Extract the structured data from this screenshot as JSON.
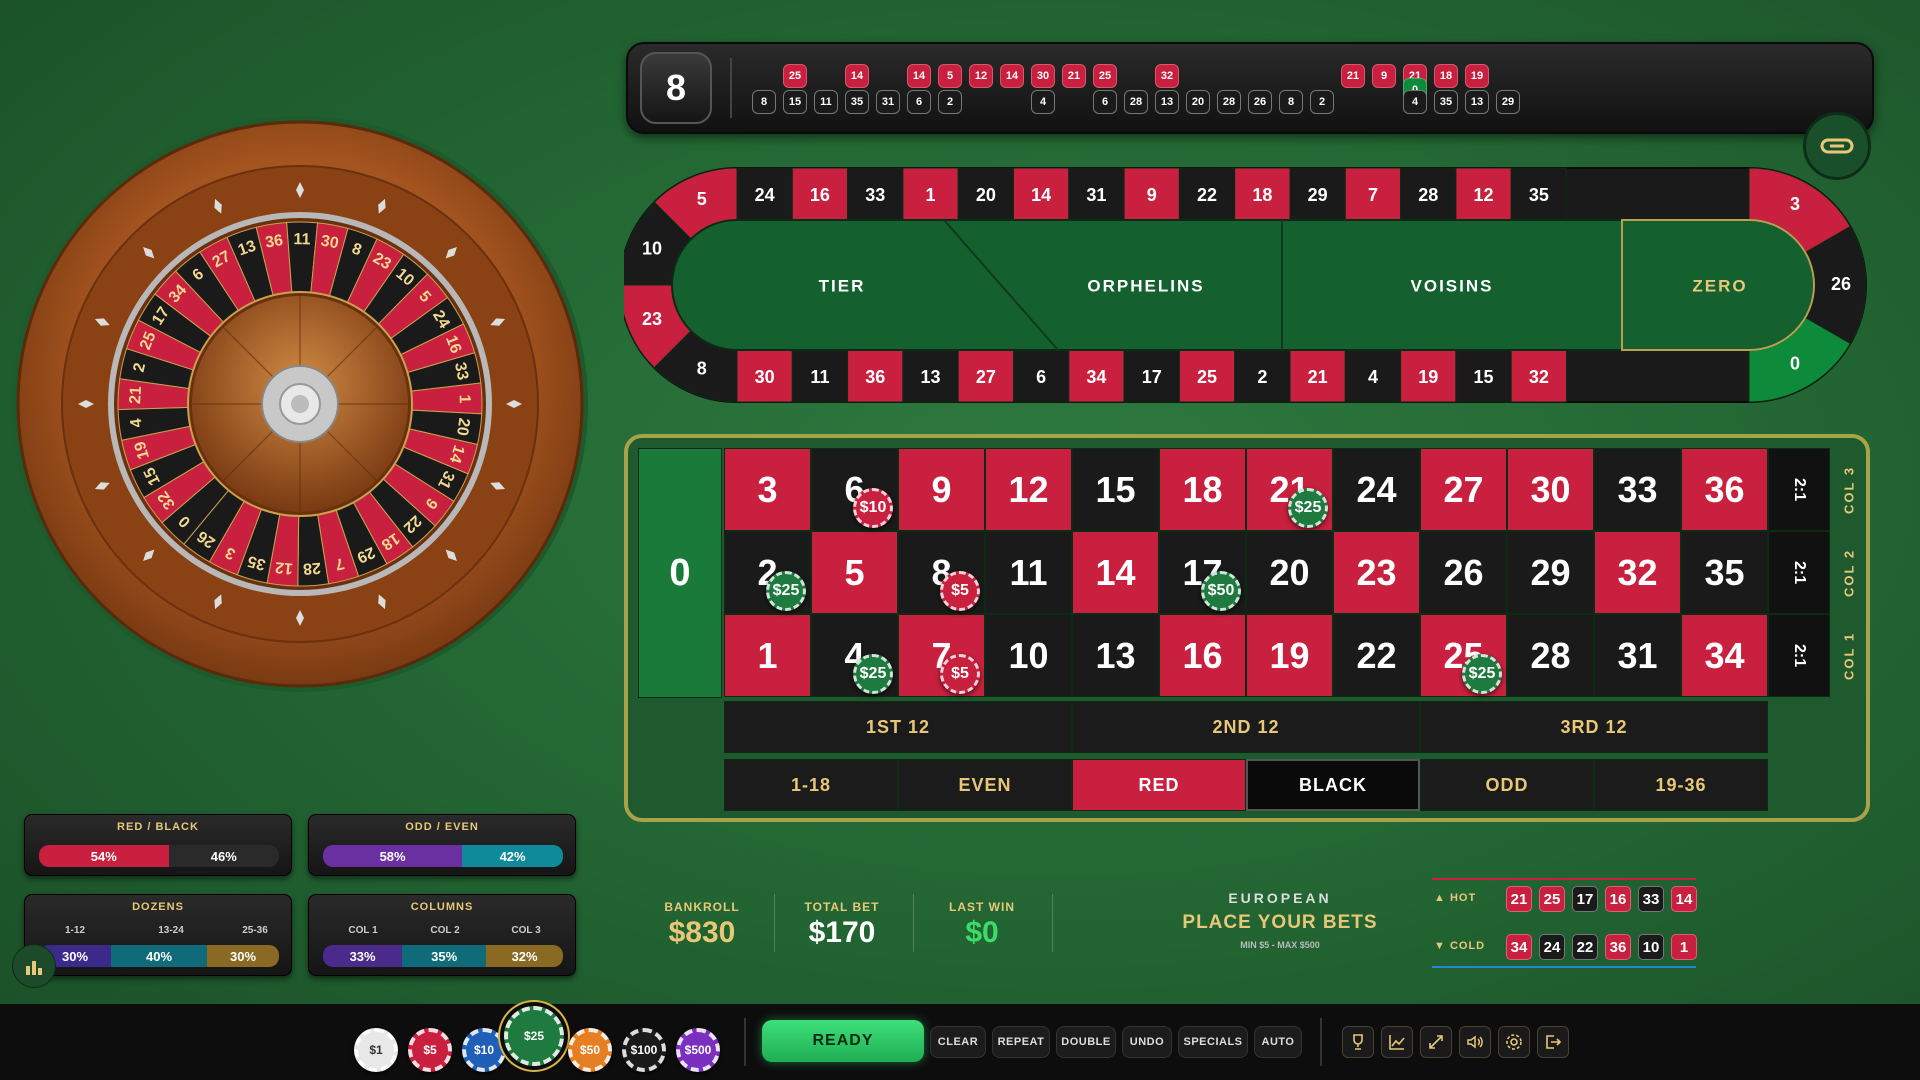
{
  "last_number": "8",
  "history": [
    {
      "n": "8",
      "c": "black",
      "row": "b"
    },
    {
      "n": "25",
      "c": "red",
      "row": "t"
    },
    {
      "n": "15",
      "c": "black",
      "row": "b"
    },
    {
      "n": "11",
      "c": "black",
      "row": "b"
    },
    {
      "n": "14",
      "c": "red",
      "row": "t"
    },
    {
      "n": "35",
      "c": "black",
      "row": "b"
    },
    {
      "n": "31",
      "c": "black",
      "row": "b"
    },
    {
      "n": "14",
      "c": "red",
      "row": "t"
    },
    {
      "n": "6",
      "c": "black",
      "row": "b"
    },
    {
      "n": "5",
      "c": "red",
      "row": "t"
    },
    {
      "n": "2",
      "c": "black",
      "row": "b"
    },
    {
      "n": "12",
      "c": "red",
      "row": "t"
    },
    {
      "n": "14",
      "c": "red",
      "row": "t"
    },
    {
      "n": "30",
      "c": "red",
      "row": "t"
    },
    {
      "n": "4",
      "c": "black",
      "row": "b"
    },
    {
      "n": "21",
      "c": "red",
      "row": "t"
    },
    {
      "n": "25",
      "c": "red",
      "row": "t"
    },
    {
      "n": "6",
      "c": "black",
      "row": "b"
    },
    {
      "n": "28",
      "c": "black",
      "row": "b"
    },
    {
      "n": "32",
      "c": "red",
      "row": "t"
    },
    {
      "n": "13",
      "c": "black",
      "row": "b"
    },
    {
      "n": "20",
      "c": "black",
      "row": "b"
    },
    {
      "n": "28",
      "c": "black",
      "row": "b"
    },
    {
      "n": "26",
      "c": "black",
      "row": "b"
    },
    {
      "n": "8",
      "c": "black",
      "row": "b"
    },
    {
      "n": "2",
      "c": "black",
      "row": "b"
    },
    {
      "n": "21",
      "c": "red",
      "row": "t"
    },
    {
      "n": "9",
      "c": "red",
      "row": "t"
    },
    {
      "n": "21",
      "c": "red",
      "row": "t"
    },
    {
      "n": "0",
      "c": "green",
      "row": "m"
    },
    {
      "n": "4",
      "c": "black",
      "row": "b"
    },
    {
      "n": "18",
      "c": "red",
      "row": "t"
    },
    {
      "n": "35",
      "c": "black",
      "row": "b"
    },
    {
      "n": "19",
      "c": "red",
      "row": "t"
    },
    {
      "n": "13",
      "c": "black",
      "row": "b"
    },
    {
      "n": "29",
      "c": "black",
      "row": "b"
    }
  ],
  "racetrack": {
    "top": [
      {
        "n": "24",
        "c": "black"
      },
      {
        "n": "16",
        "c": "red"
      },
      {
        "n": "33",
        "c": "black"
      },
      {
        "n": "1",
        "c": "red"
      },
      {
        "n": "20",
        "c": "black"
      },
      {
        "n": "14",
        "c": "red"
      },
      {
        "n": "31",
        "c": "black"
      },
      {
        "n": "9",
        "c": "red"
      },
      {
        "n": "22",
        "c": "black"
      },
      {
        "n": "18",
        "c": "red"
      },
      {
        "n": "29",
        "c": "black"
      },
      {
        "n": "7",
        "c": "red"
      },
      {
        "n": "28",
        "c": "black"
      },
      {
        "n": "12",
        "c": "red"
      },
      {
        "n": "35",
        "c": "black"
      }
    ],
    "bottom": [
      {
        "n": "30",
        "c": "red"
      },
      {
        "n": "11",
        "c": "black"
      },
      {
        "n": "36",
        "c": "red"
      },
      {
        "n": "13",
        "c": "black"
      },
      {
        "n": "27",
        "c": "red"
      },
      {
        "n": "6",
        "c": "black"
      },
      {
        "n": "34",
        "c": "red"
      },
      {
        "n": "17",
        "c": "black"
      },
      {
        "n": "25",
        "c": "red"
      },
      {
        "n": "2",
        "c": "black"
      },
      {
        "n": "21",
        "c": "red"
      },
      {
        "n": "4",
        "c": "black"
      },
      {
        "n": "19",
        "c": "red"
      },
      {
        "n": "15",
        "c": "black"
      },
      {
        "n": "32",
        "c": "red"
      }
    ],
    "left": [
      {
        "n": "5",
        "c": "red"
      },
      {
        "n": "10",
        "c": "black"
      },
      {
        "n": "23",
        "c": "red"
      },
      {
        "n": "8",
        "c": "black"
      }
    ],
    "right": [
      {
        "n": "3",
        "c": "red"
      },
      {
        "n": "26",
        "c": "black"
      },
      {
        "n": "0",
        "c": "green"
      }
    ],
    "sections": [
      "TIER",
      "ORPHELINS",
      "VOISINS",
      "ZERO"
    ]
  },
  "wheel_sequence": [
    "0",
    "32",
    "15",
    "19",
    "4",
    "21",
    "2",
    "25",
    "17",
    "34",
    "6",
    "27",
    "13",
    "36",
    "11",
    "30",
    "8",
    "23",
    "10",
    "5",
    "24",
    "16",
    "33",
    "1",
    "20",
    "14",
    "31",
    "9",
    "22",
    "18",
    "29",
    "7",
    "28",
    "12",
    "35",
    "3",
    "26"
  ],
  "board": {
    "zero": "0",
    "row3": [
      {
        "n": "3",
        "c": "red"
      },
      {
        "n": "6",
        "c": "black"
      },
      {
        "n": "9",
        "c": "red"
      },
      {
        "n": "12",
        "c": "red"
      },
      {
        "n": "15",
        "c": "black"
      },
      {
        "n": "18",
        "c": "red"
      },
      {
        "n": "21",
        "c": "red"
      },
      {
        "n": "24",
        "c": "black"
      },
      {
        "n": "27",
        "c": "red"
      },
      {
        "n": "30",
        "c": "red"
      },
      {
        "n": "33",
        "c": "black"
      },
      {
        "n": "36",
        "c": "red"
      }
    ],
    "row2": [
      {
        "n": "2",
        "c": "black"
      },
      {
        "n": "5",
        "c": "red"
      },
      {
        "n": "8",
        "c": "black"
      },
      {
        "n": "11",
        "c": "black"
      },
      {
        "n": "14",
        "c": "red"
      },
      {
        "n": "17",
        "c": "black"
      },
      {
        "n": "20",
        "c": "black"
      },
      {
        "n": "23",
        "c": "red"
      },
      {
        "n": "26",
        "c": "black"
      },
      {
        "n": "29",
        "c": "black"
      },
      {
        "n": "32",
        "c": "red"
      },
      {
        "n": "35",
        "c": "black"
      }
    ],
    "row1": [
      {
        "n": "1",
        "c": "red"
      },
      {
        "n": "4",
        "c": "black"
      },
      {
        "n": "7",
        "c": "red"
      },
      {
        "n": "10",
        "c": "black"
      },
      {
        "n": "13",
        "c": "black"
      },
      {
        "n": "16",
        "c": "red"
      },
      {
        "n": "19",
        "c": "red"
      },
      {
        "n": "22",
        "c": "black"
      },
      {
        "n": "25",
        "c": "red"
      },
      {
        "n": "28",
        "c": "black"
      },
      {
        "n": "31",
        "c": "black"
      },
      {
        "n": "34",
        "c": "red"
      }
    ],
    "two_to_one": "2:1",
    "col_labels": [
      "COL 3",
      "COL 2",
      "COL 1"
    ],
    "dozens": [
      "1ST 12",
      "2ND 12",
      "3RD 12"
    ],
    "outside": [
      "1-18",
      "EVEN",
      "RED",
      "BLACK",
      "ODD",
      "19-36"
    ]
  },
  "placed_chips": [
    {
      "on": "6",
      "label": "$10",
      "color": "red"
    },
    {
      "on": "21",
      "label": "$25",
      "color": "green"
    },
    {
      "on": "2",
      "label": "$25",
      "color": "green"
    },
    {
      "on": "8",
      "label": "$5",
      "color": "red"
    },
    {
      "on": "17",
      "label": "$50",
      "color": "green"
    },
    {
      "on": "4",
      "label": "$25",
      "color": "green"
    },
    {
      "on": "7",
      "label": "$5",
      "color": "red"
    },
    {
      "on": "25",
      "label": "$25",
      "color": "green"
    }
  ],
  "stats": {
    "red_black": {
      "title": "RED / BLACK",
      "red": "54%",
      "black": "46%",
      "red_frac": 0.54
    },
    "odd_even": {
      "title": "ODD / EVEN",
      "odd": "58%",
      "even": "42%",
      "odd_frac": 0.58
    },
    "dozens": {
      "title": "DOZENS",
      "labels": [
        "1-12",
        "13-24",
        "25-36"
      ],
      "values": [
        "30%",
        "40%",
        "30%"
      ],
      "fracs": [
        0.3,
        0.4,
        0.3
      ]
    },
    "columns": {
      "title": "COLUMNS",
      "labels": [
        "COL 1",
        "COL 2",
        "COL 3"
      ],
      "values": [
        "33%",
        "35%",
        "32%"
      ],
      "fracs": [
        0.33,
        0.35,
        0.32
      ]
    }
  },
  "info": {
    "bankroll_label": "BANKROLL",
    "bankroll": "$830",
    "total_bet_label": "TOTAL BET",
    "total_bet": "$170",
    "last_win_label": "LAST WIN",
    "last_win": "$0",
    "variant": "EUROPEAN",
    "status": "PLACE YOUR BETS",
    "limits": "MIN $5 - MAX $500"
  },
  "hot_cold": {
    "hot_label": "▲ HOT",
    "cold_label": "▼ COLD",
    "hot": [
      {
        "n": "21",
        "c": "red"
      },
      {
        "n": "25",
        "c": "red"
      },
      {
        "n": "17",
        "c": "black"
      },
      {
        "n": "16",
        "c": "red"
      },
      {
        "n": "33",
        "c": "black"
      },
      {
        "n": "14",
        "c": "red"
      }
    ],
    "cold": [
      {
        "n": "34",
        "c": "red"
      },
      {
        "n": "24",
        "c": "black"
      },
      {
        "n": "22",
        "c": "black"
      },
      {
        "n": "36",
        "c": "red"
      },
      {
        "n": "10",
        "c": "black"
      },
      {
        "n": "1",
        "c": "red"
      }
    ]
  },
  "chips": [
    {
      "label": "$1",
      "color": "#e8e8e8",
      "text": "#333"
    },
    {
      "label": "$5",
      "color": "#c8203e",
      "text": "#fff"
    },
    {
      "label": "$10",
      "color": "#1f5fb8",
      "text": "#fff"
    },
    {
      "label": "$25",
      "color": "#1e7a3e",
      "text": "#fff",
      "selected": true
    },
    {
      "label": "$50",
      "color": "#e67e22",
      "text": "#fff"
    },
    {
      "label": "$100",
      "color": "#1a1a1a",
      "text": "#fff"
    },
    {
      "label": "$500",
      "color": "#7b2fbf",
      "text": "#fff"
    }
  ],
  "buttons": {
    "ready": "READY",
    "clear": "CLEAR",
    "repeat": "REPEAT",
    "double": "DOUBLE",
    "undo": "UNDO",
    "specials": "SPECIALS",
    "auto": "AUTO"
  },
  "icons": [
    "trophy-icon",
    "chart-line-icon",
    "fullscreen-icon",
    "sound-icon",
    "settings-icon",
    "exit-icon"
  ],
  "colors": {
    "red": "#c8203e",
    "black": "#1a1a1a",
    "green": "#0d8a3a",
    "gold": "#e8c878",
    "ready": "#2ecc71"
  }
}
